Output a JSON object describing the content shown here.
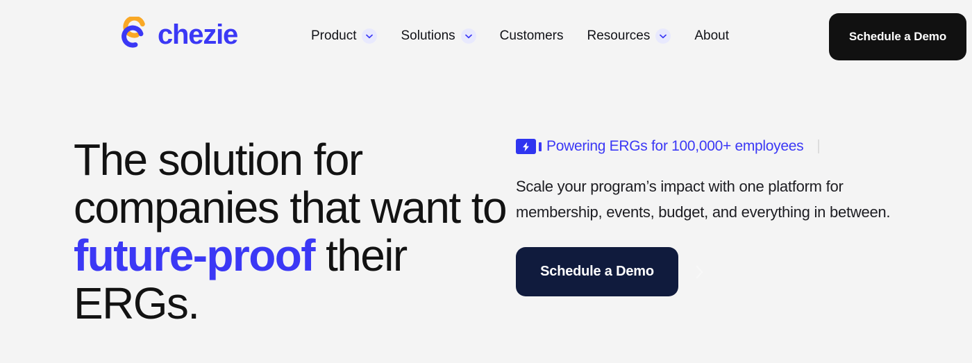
{
  "colors": {
    "background": "#f4f4f4",
    "brand_blue": "#3b38f5",
    "brand_orange": "#f9a826",
    "nav_button_bg": "#111111",
    "hero_button_bg": "#101b3d",
    "chevron_circle_bg": "#e8e9fd",
    "text_dark": "#121212",
    "divider": "#dcdcdc"
  },
  "header": {
    "logo": {
      "mark_icon": "chezie-double-c-icon",
      "wordmark": "chezie"
    },
    "nav_items": [
      {
        "label": "Product",
        "has_dropdown": true,
        "icon": "chevron-down-icon"
      },
      {
        "label": "Solutions",
        "has_dropdown": true,
        "icon": "chevron-down-icon"
      },
      {
        "label": "Customers",
        "has_dropdown": false,
        "icon": ""
      },
      {
        "label": "Resources",
        "has_dropdown": true,
        "icon": "chevron-down-icon"
      },
      {
        "label": "About",
        "has_dropdown": false,
        "icon": ""
      }
    ],
    "cta_label": "Schedule a Demo"
  },
  "hero": {
    "headline": {
      "part1": "The solution for companies that want to ",
      "highlight": "future-proof",
      "part2": " their ERGs."
    },
    "eyebrow": {
      "icon": "lightning-bolt-icon",
      "text": "Powering ERGs for 100,000+ employees"
    },
    "subhead": "Scale your program’s impact with one platform for membership, events, budget, and everything in between.",
    "cta_label": "Schedule a Demo",
    "cta_next_icon": "chevron-right-icon"
  }
}
